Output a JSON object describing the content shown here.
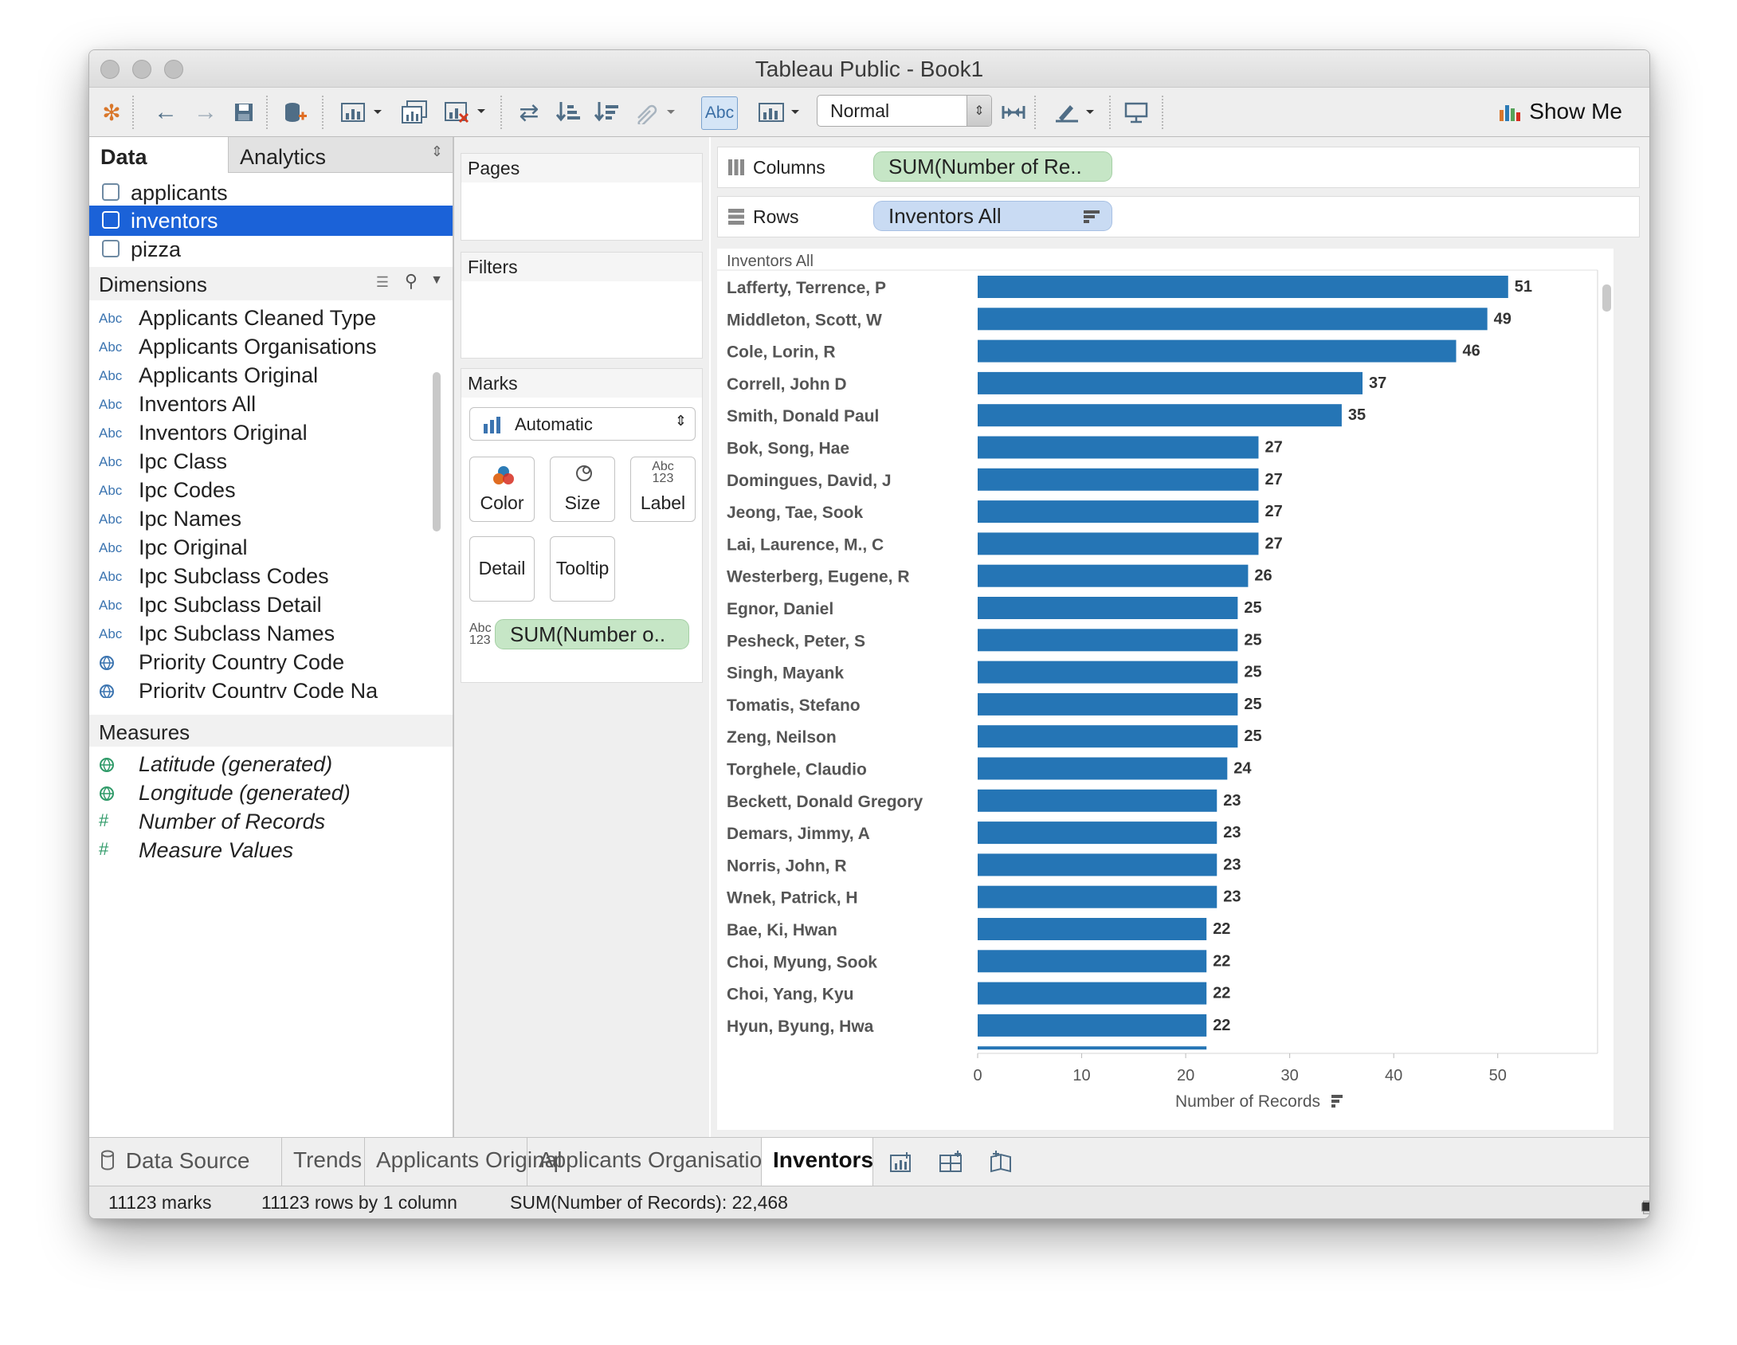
{
  "window": {
    "title": "Tableau Public - Book1"
  },
  "toolbar": {
    "mark_type_view": "Normal",
    "show_me": "Show Me",
    "abc_toggle": "Abc"
  },
  "data_pane": {
    "tabs": [
      "Data",
      "Analytics"
    ],
    "data_sources": [
      {
        "label": "applicants",
        "selected": false
      },
      {
        "label": "inventors",
        "selected": true
      },
      {
        "label": "pizza",
        "selected": false
      }
    ],
    "dimensions_header": "Dimensions",
    "dimensions": [
      {
        "type": "Abc",
        "label": "Applicants Cleaned Type"
      },
      {
        "type": "Abc",
        "label": "Applicants Organisations"
      },
      {
        "type": "Abc",
        "label": "Applicants Original"
      },
      {
        "type": "Abc",
        "label": "Inventors All"
      },
      {
        "type": "Abc",
        "label": "Inventors Original"
      },
      {
        "type": "Abc",
        "label": "Ipc Class"
      },
      {
        "type": "Abc",
        "label": "Ipc Codes"
      },
      {
        "type": "Abc",
        "label": "Ipc Names"
      },
      {
        "type": "Abc",
        "label": "Ipc Original"
      },
      {
        "type": "Abc",
        "label": "Ipc Subclass Codes"
      },
      {
        "type": "Abc",
        "label": "Ipc Subclass Detail"
      },
      {
        "type": "Abc",
        "label": "Ipc Subclass Names"
      },
      {
        "type": "globe",
        "label": "Priority Country Code"
      },
      {
        "type": "globe",
        "label": "Priority Country Code Na"
      }
    ],
    "measures_header": "Measures",
    "measures": [
      {
        "type": "globe",
        "label": "Latitude (generated)"
      },
      {
        "type": "globe",
        "label": "Longitude (generated)"
      },
      {
        "type": "hash",
        "label": "Number of Records"
      },
      {
        "type": "hash",
        "label": "Measure Values"
      }
    ]
  },
  "shelves": {
    "pages_title": "Pages",
    "filters_title": "Filters",
    "marks_title": "Marks",
    "marks_type": "Automatic",
    "marks_buttons": [
      "Color",
      "Size",
      "Label",
      "Detail",
      "Tooltip"
    ],
    "marks_pill": "SUM(Number o..",
    "label_icon_top": "Abc",
    "label_icon_bottom": "123",
    "columns_label": "Columns",
    "columns_pill": "SUM(Number of Re..",
    "rows_label": "Rows",
    "rows_pill": "Inventors All"
  },
  "colors": {
    "bar": "#2575b5",
    "selection": "#1b62d8",
    "green_pill": "#c6e6c6",
    "blue_pill": "#c9dbf3"
  },
  "chart_data": {
    "type": "bar",
    "orientation": "horizontal",
    "row_header": "Inventors All",
    "xlabel": "Number of Records",
    "xlim": [
      0,
      55
    ],
    "xticks": [
      0,
      10,
      20,
      30,
      40,
      50
    ],
    "categories": [
      "Lafferty, Terrence, P",
      "Middleton, Scott, W",
      "Cole, Lorin, R",
      "Correll, John D",
      "Smith, Donald Paul",
      "Bok, Song, Hae",
      "Domingues, David, J",
      "Jeong, Tae, Sook",
      "Lai, Laurence, M., C",
      "Westerberg, Eugene, R",
      "Egnor, Daniel",
      "Pesheck, Peter, S",
      "Singh, Mayank",
      "Tomatis, Stefano",
      "Zeng, Neilson",
      "Torghele, Claudio",
      "Beckett, Donald Gregory",
      "Demars, Jimmy, A",
      "Norris, John, R",
      "Wnek, Patrick, H",
      "Bae, Ki, Hwan",
      "Choi, Myung, Sook",
      "Choi, Yang, Kyu",
      "Hyun, Byung, Hwa"
    ],
    "values": [
      51,
      49,
      46,
      37,
      35,
      27,
      27,
      27,
      27,
      26,
      25,
      25,
      25,
      25,
      25,
      24,
      23,
      23,
      23,
      23,
      22,
      22,
      22,
      22
    ],
    "grid": false
  },
  "bottom_tabs": [
    "Data Source",
    "Trends",
    "Applicants Original",
    "Applicants Organisations",
    "Inventors"
  ],
  "active_tab": "Inventors",
  "status": {
    "marks": "11123 marks",
    "rows": "11123 rows by 1 column",
    "sum": "SUM(Number of Records): 22,468"
  }
}
